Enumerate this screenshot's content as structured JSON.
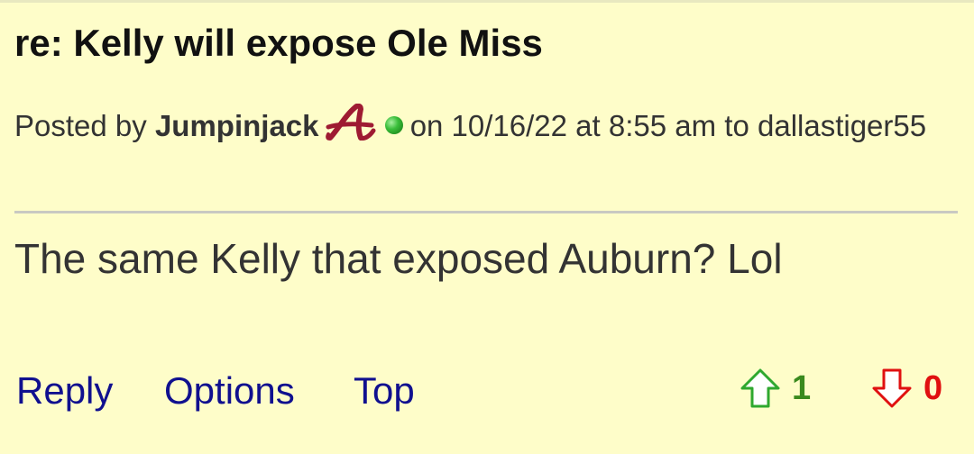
{
  "post": {
    "title": "re: Kelly will expose Ole Miss",
    "byline": {
      "prefix": "Posted by",
      "author": "Jumpinjack",
      "team_icon": "alabama-script-a-icon",
      "online_icon": "online-status-icon",
      "timestamp_text": "on 10/16/22 at 8:55 am to",
      "reply_to": "dallastiger55"
    },
    "body": "The same Kelly that exposed Auburn? Lol"
  },
  "actions": {
    "reply": "Reply",
    "options": "Options",
    "top": "Top"
  },
  "votes": {
    "up_count": "1",
    "down_count": "0",
    "up_icon": "thumb-up-arrow-icon",
    "down_icon": "thumb-down-arrow-icon"
  },
  "colors": {
    "background": "#fefdc9",
    "link": "#10108f",
    "upvote": "#3a8a1e",
    "downvote": "#e01010",
    "team_crimson": "#9e1b32"
  }
}
